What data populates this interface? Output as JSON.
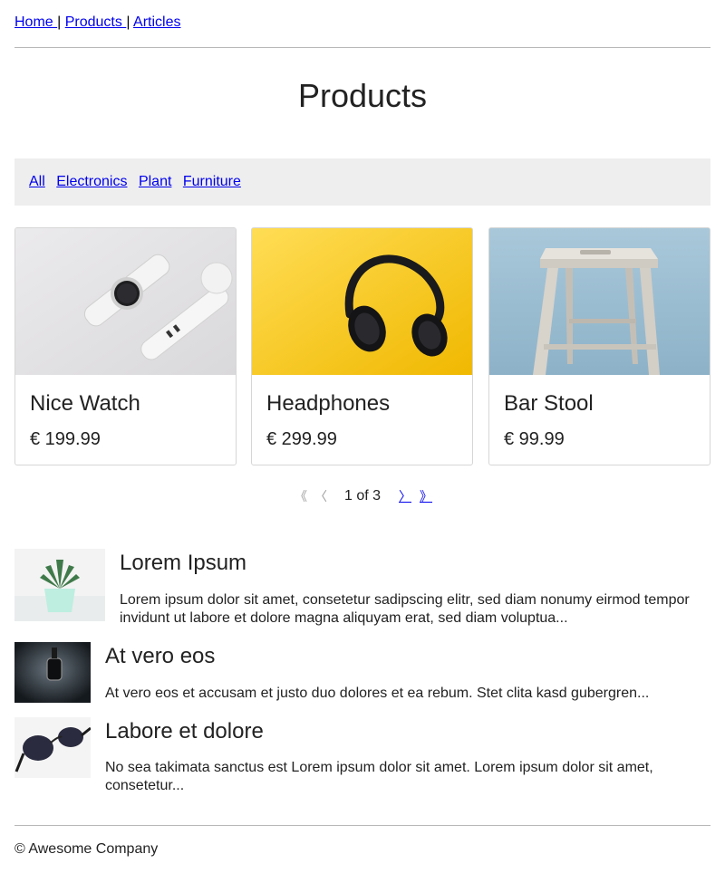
{
  "nav": {
    "links": [
      "Home ",
      "Products ",
      "Articles"
    ],
    "separator": "|"
  },
  "page_title": "Products",
  "filters": [
    "All",
    "Electronics",
    "Plant",
    "Furniture"
  ],
  "products": [
    {
      "name": "Nice Watch",
      "price": "€ 199.99",
      "image_icon": "smartwatch-image",
      "image_bg": "#e3e2e4"
    },
    {
      "name": "Headphones",
      "price": "€ 299.99",
      "image_icon": "headphones-image",
      "image_bg": "#f6c91c"
    },
    {
      "name": "Bar Stool",
      "price": "€ 99.99",
      "image_icon": "bar-stool-image",
      "image_bg": "#9ebfd2"
    }
  ],
  "pagination": {
    "first": "《",
    "prev": "〈",
    "status": "1 of 3",
    "next": "〉",
    "last": "》"
  },
  "articles": [
    {
      "title": "Lorem Ipsum",
      "text": "Lorem ipsum dolor sit amet, consetetur sadipscing elitr, sed diam nonumy eirmod tempor invidunt ut labore et dolore magna aliquyam erat, sed diam voluptua...",
      "image_icon": "succulent-plant-image"
    },
    {
      "title": "At vero eos",
      "text": "At vero eos et accusam et justo duo dolores et ea rebum. Stet clita kasd gubergren...",
      "image_icon": "dark-watch-image"
    },
    {
      "title": "Labore et dolore",
      "text": "No sea takimata sanctus est Lorem ipsum dolor sit amet. Lorem ipsum dolor sit amet, consetetur...",
      "image_icon": "sunglasses-image"
    }
  ],
  "footer": "© Awesome Company",
  "colors": {
    "link": "#0000ee",
    "filter_bg": "#eeeeee",
    "text": "#222222"
  }
}
